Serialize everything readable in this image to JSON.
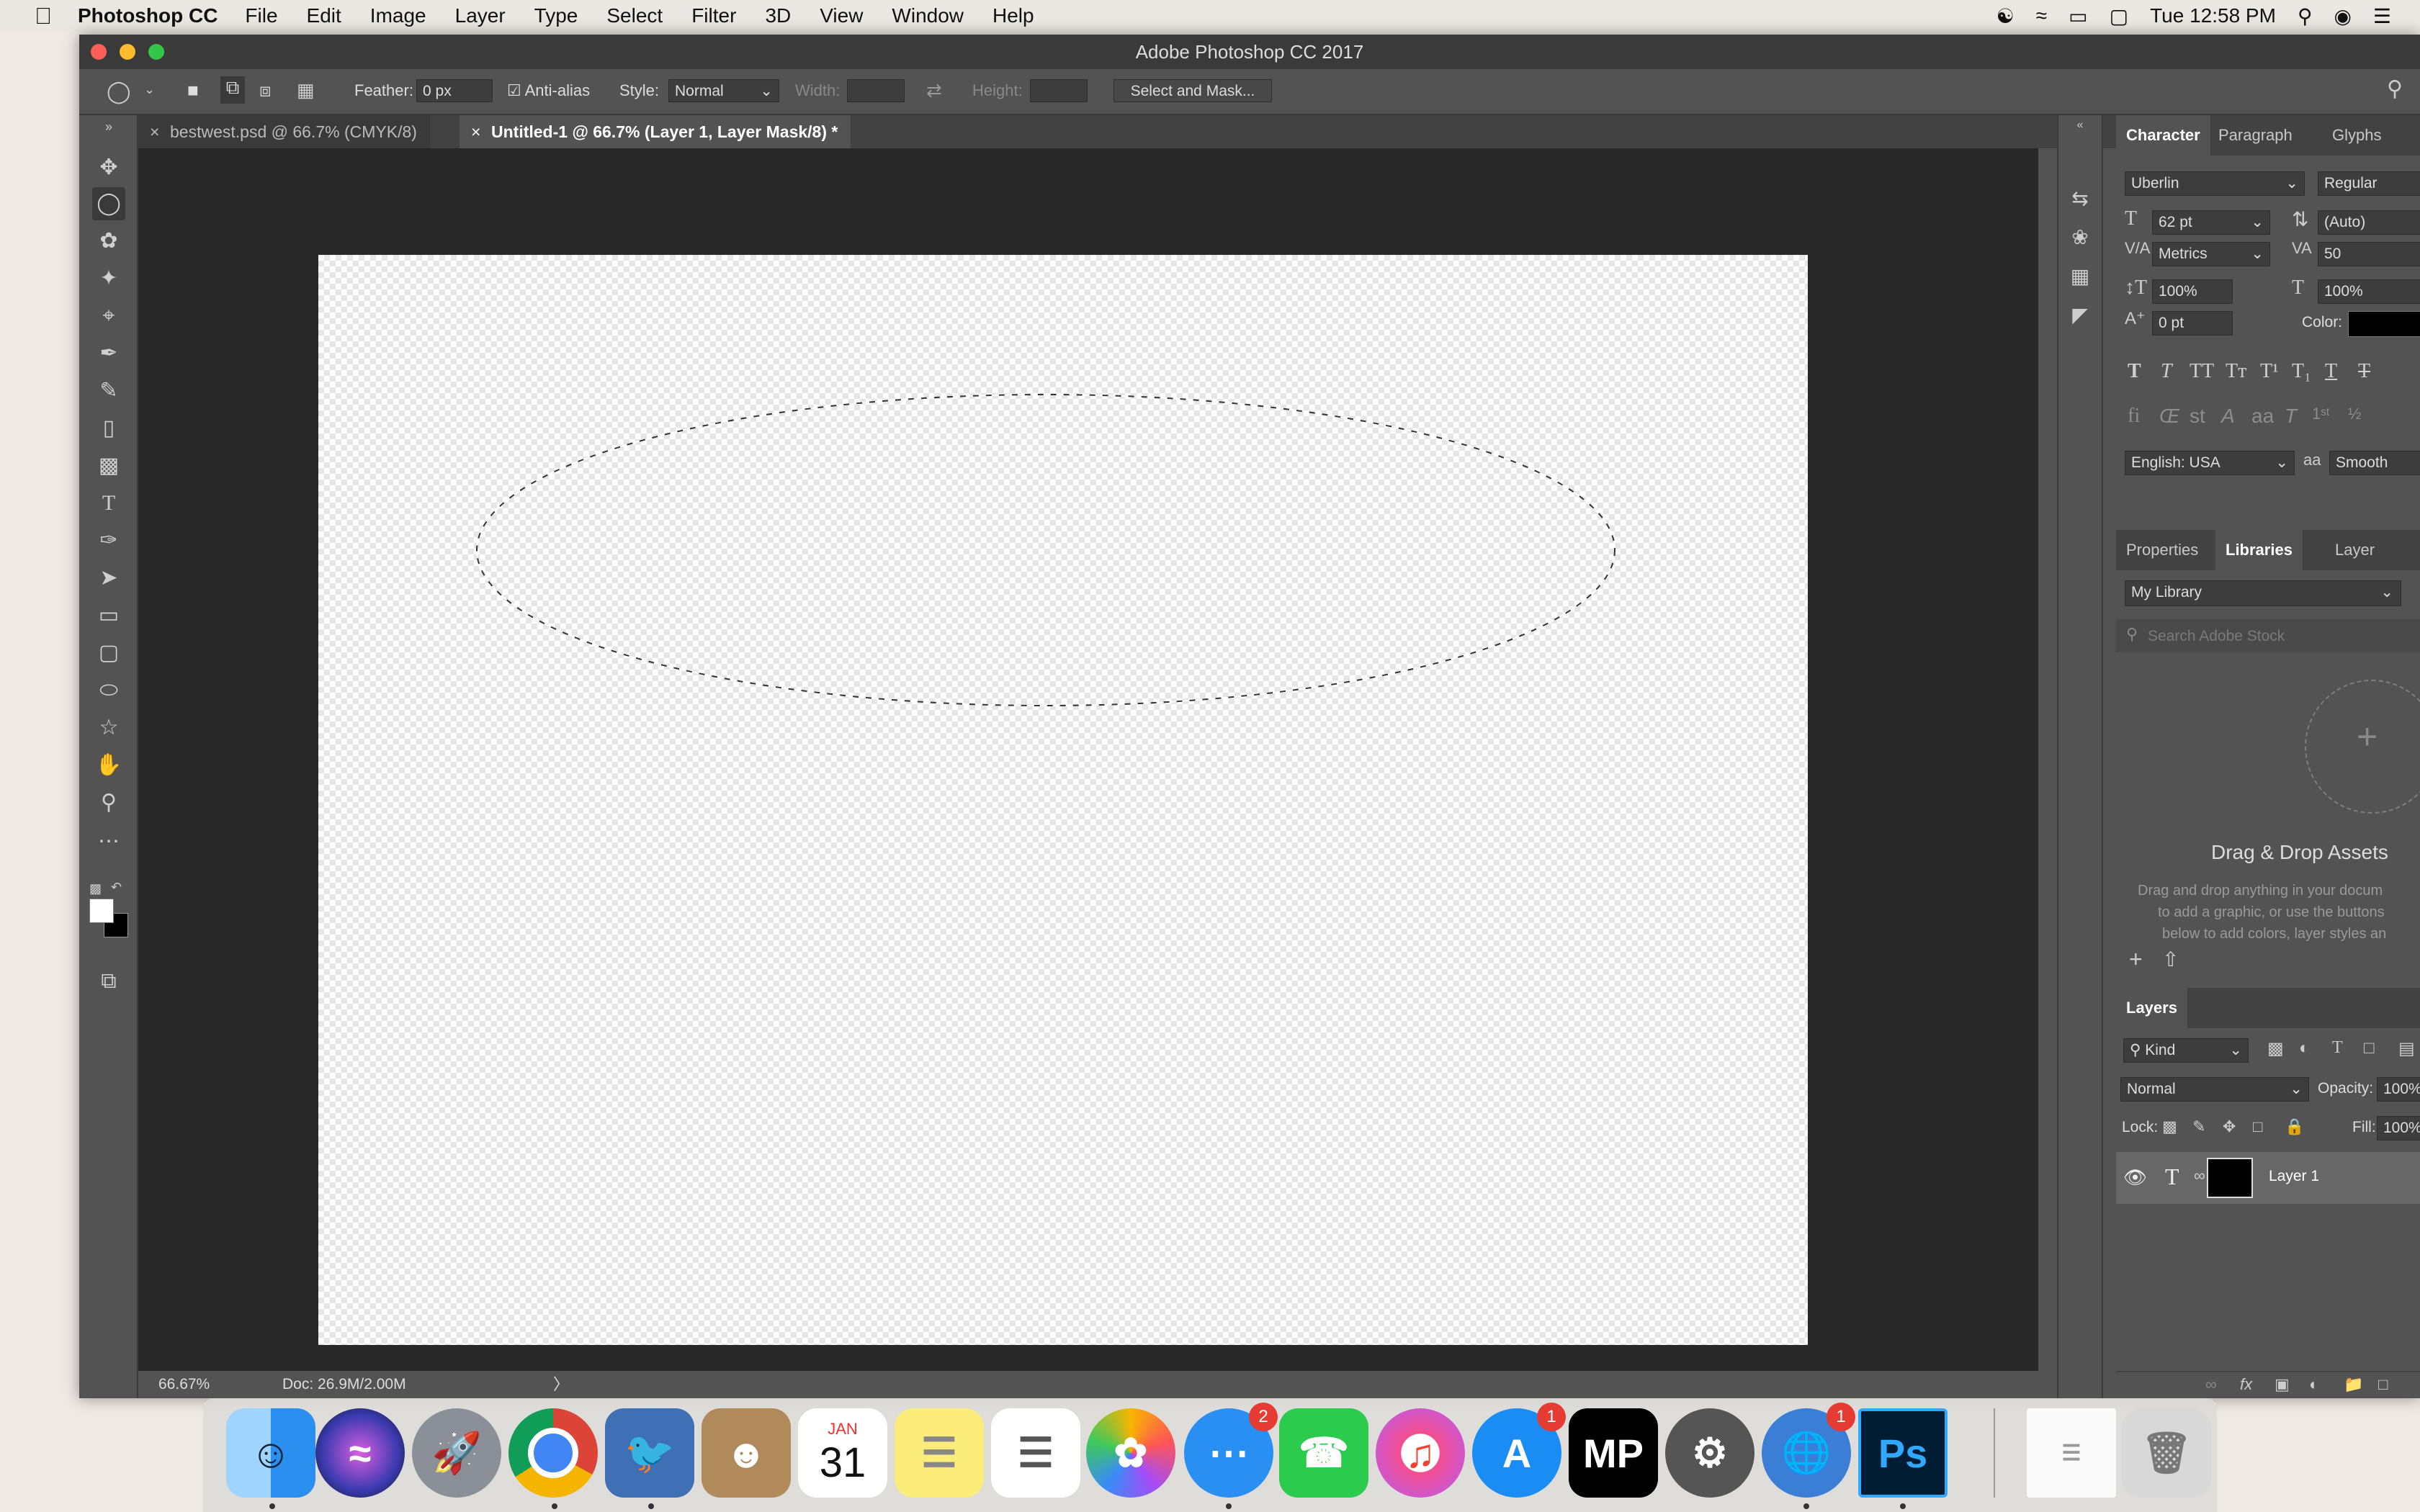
{
  "menubar": {
    "app_name": "Photoshop CC",
    "menus": [
      "File",
      "Edit",
      "Image",
      "Layer",
      "Type",
      "Select",
      "Filter",
      "3D",
      "View",
      "Window",
      "Help"
    ],
    "clock": "Tue 12:58 PM"
  },
  "window": {
    "title": "Adobe Photoshop CC 2017"
  },
  "options": {
    "feather_label": "Feather:",
    "feather_value": "0 px",
    "antialias_label": "Anti-alias",
    "style_label": "Style:",
    "style_value": "Normal",
    "width_label": "Width:",
    "height_label": "Height:",
    "select_mask_label": "Select and Mask..."
  },
  "tabs": [
    {
      "label": "bestwest.psd @ 66.7% (CMYK/8)"
    },
    {
      "label": "Untitled-1 @ 66.7% (Layer 1, Layer Mask/8) *"
    }
  ],
  "status": {
    "zoom": "66.67%",
    "doc": "Doc: 26.9M/2.00M"
  },
  "character_panel": {
    "tabs": [
      "Character",
      "Paragraph",
      "Glyphs"
    ],
    "font_family": "Uberlin",
    "font_style": "Regular",
    "font_size": "62 pt",
    "leading": "(Auto)",
    "kerning": "Metrics",
    "tracking": "50",
    "vscale": "100%",
    "hscale": "100%",
    "baseline": "0 pt",
    "color_label": "Color:",
    "language": "English: USA",
    "antialias": "Smooth",
    "aa_icon_label": "aa"
  },
  "libraries_panel": {
    "tabs": [
      "Properties",
      "Libraries",
      "Layer Comps"
    ],
    "library": "My Library",
    "search_placeholder": "Search Adobe Stock",
    "drop_title": "Drag & Drop Assets",
    "drop_text_1": "Drag and drop anything in your docum",
    "drop_text_2": "to add a graphic, or use the buttons",
    "drop_text_3": "below to add colors, layer styles an"
  },
  "layers_panel": {
    "title": "Layers",
    "filter_kind": "Kind",
    "blend_mode": "Normal",
    "opacity_label": "Opacity:",
    "opacity_value": "100%",
    "lock_label": "Lock:",
    "fill_label": "Fill:",
    "fill_value": "100%",
    "layers": [
      {
        "name": "Layer 1"
      }
    ]
  },
  "dock": {
    "badges": {
      "messages": "2",
      "appstore": "1",
      "network": "1"
    },
    "calendar_month": "JAN",
    "calendar_day": "31",
    "mp_label": "MP",
    "ps_label": "Ps"
  },
  "colors": {
    "accent": "#31a8ff",
    "ps_bg": "#535353",
    "canvas_bg": "#282828"
  }
}
